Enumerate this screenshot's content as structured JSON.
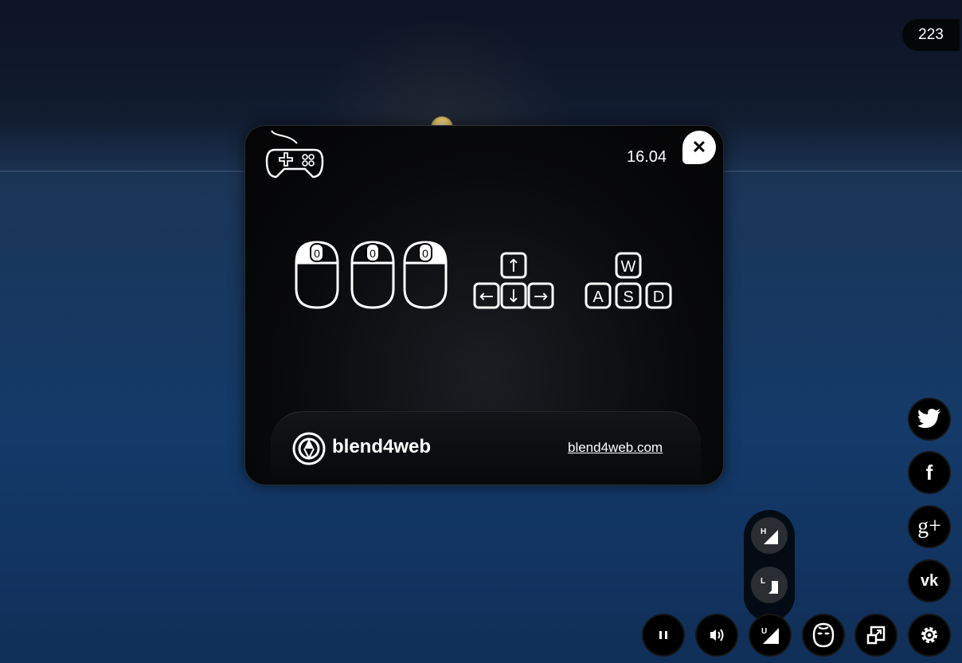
{
  "counter": "223",
  "dialog": {
    "version": "16.04",
    "close_glyph": "✕",
    "mouse_key_labels": [
      "0",
      "0",
      "0"
    ],
    "arrow_keys": [
      "↑",
      "←",
      "↓",
      "→"
    ],
    "wasd_keys": [
      "W",
      "A",
      "S",
      "D"
    ],
    "logo_text": "blend4web",
    "site_link": "blend4web.com"
  },
  "social": {
    "facebook": "f",
    "googleplus": "g+",
    "vk": "vk"
  },
  "quality": {
    "high": "H",
    "low": "L",
    "ultra": "U"
  },
  "icons": [
    "gamepad-icon",
    "mouse-left-icon",
    "mouse-middle-icon",
    "mouse-right-icon",
    "arrow-keys-icon",
    "wasd-keys-icon",
    "blend4web-logo-icon",
    "twitter-icon",
    "facebook-icon",
    "googleplus-icon",
    "vk-icon",
    "pause-icon",
    "sound-icon",
    "stereo-icon",
    "fullscreen-icon",
    "settings-icon"
  ],
  "colors": {
    "accent": "#ffffff",
    "panel": "#050608"
  }
}
